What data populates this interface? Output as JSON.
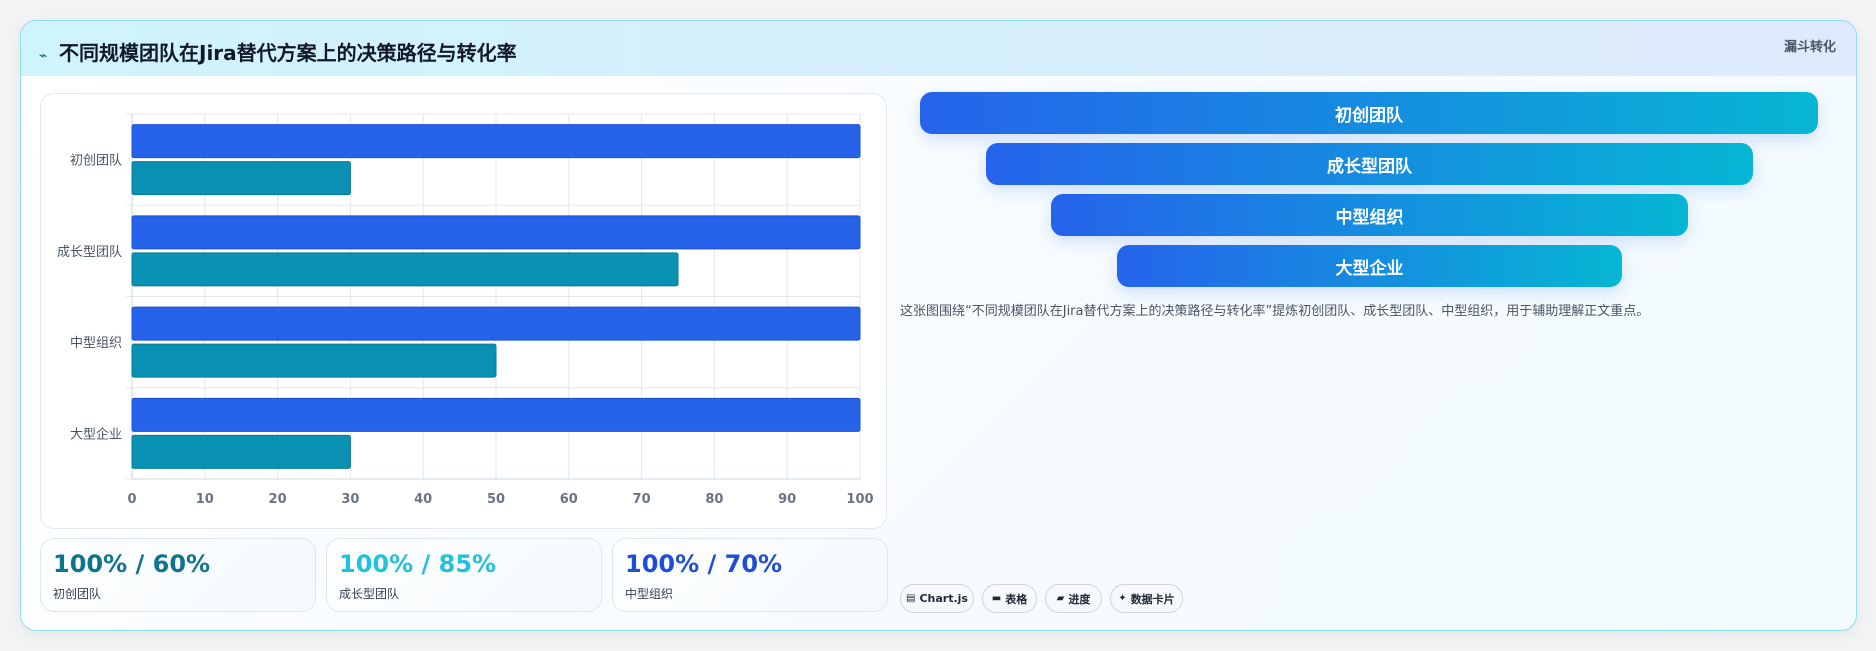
{
  "header": {
    "title": "不同规模团队在Jira替代方案上的决策路径与转化率",
    "badge": "漏斗转化"
  },
  "chart_data": {
    "type": "bar",
    "orientation": "horizontal",
    "categories": [
      "初创团队",
      "成长型团队",
      "中型组织",
      "大型企业"
    ],
    "series": [
      {
        "values": [
          100,
          100,
          100,
          100
        ],
        "color": "#2563eb"
      },
      {
        "values": [
          30,
          75,
          50,
          30
        ],
        "color": "#0891b2"
      }
    ],
    "xlim": [
      0,
      100
    ],
    "xticks": [
      0,
      10,
      20,
      30,
      40,
      50,
      60,
      70,
      80,
      90,
      100
    ],
    "grid": true,
    "legend": "none"
  },
  "stats": [
    {
      "value": "100% / 60%",
      "label": "初创团队",
      "color": "#0e7490"
    },
    {
      "value": "100% / 85%",
      "label": "成长型团队",
      "color": "#22c1dc"
    },
    {
      "value": "100% / 70%",
      "label": "中型组织",
      "color": "#1d4ed8"
    }
  ],
  "funnel": [
    "初创团队",
    "成长型团队",
    "中型组织",
    "大型企业"
  ],
  "description": "这张图围绕“不同规模团队在Jira替代方案上的决策路径与转化率”提炼初创团队、成长型团队、中型组织，用于辅助理解正文重点。",
  "chips": [
    {
      "icon": "chart-icon",
      "label": "Chart.js"
    },
    {
      "icon": "table-icon",
      "label": "表格"
    },
    {
      "icon": "progress-icon",
      "label": "进度"
    },
    {
      "icon": "sparkle-icon",
      "label": "数据卡片"
    }
  ],
  "colors": {
    "accent_blue": "#2563eb",
    "accent_teal": "#0891b2"
  }
}
